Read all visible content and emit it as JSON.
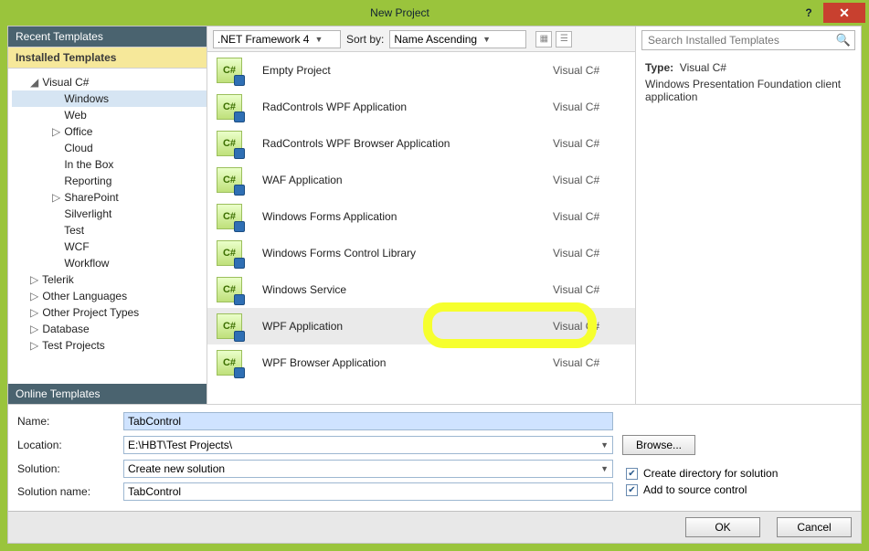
{
  "window": {
    "title": "New Project",
    "help": "?",
    "close": "✕"
  },
  "sidebar": {
    "headers": {
      "recent": "Recent Templates",
      "installed": "Installed Templates",
      "online": "Online Templates"
    },
    "tree": [
      {
        "label": "Visual C#",
        "depth": 1,
        "twisty": "◢",
        "exp": true
      },
      {
        "label": "Windows",
        "depth": 2,
        "twisty": "",
        "sel": true
      },
      {
        "label": "Web",
        "depth": 2,
        "twisty": ""
      },
      {
        "label": "Office",
        "depth": 2,
        "twisty": "▷"
      },
      {
        "label": "Cloud",
        "depth": 2,
        "twisty": ""
      },
      {
        "label": "In the Box",
        "depth": 2,
        "twisty": ""
      },
      {
        "label": "Reporting",
        "depth": 2,
        "twisty": ""
      },
      {
        "label": "SharePoint",
        "depth": 2,
        "twisty": "▷"
      },
      {
        "label": "Silverlight",
        "depth": 2,
        "twisty": ""
      },
      {
        "label": "Test",
        "depth": 2,
        "twisty": ""
      },
      {
        "label": "WCF",
        "depth": 2,
        "twisty": ""
      },
      {
        "label": "Workflow",
        "depth": 2,
        "twisty": ""
      },
      {
        "label": "Telerik",
        "depth": 1,
        "twisty": "▷"
      },
      {
        "label": "Other Languages",
        "depth": 1,
        "twisty": "▷"
      },
      {
        "label": "Other Project Types",
        "depth": 1,
        "twisty": "▷"
      },
      {
        "label": "Database",
        "depth": 1,
        "twisty": "▷"
      },
      {
        "label": "Test Projects",
        "depth": 1,
        "twisty": "▷"
      }
    ]
  },
  "toolbar": {
    "framework": ".NET Framework 4",
    "sortby_label": "Sort by:",
    "sortby_value": "Name Ascending"
  },
  "templates": [
    {
      "name": "Empty Project",
      "lang": "Visual C#"
    },
    {
      "name": "RadControls WPF Application",
      "lang": "Visual C#"
    },
    {
      "name": "RadControls WPF Browser Application",
      "lang": "Visual C#"
    },
    {
      "name": "WAF Application",
      "lang": "Visual C#"
    },
    {
      "name": "Windows Forms Application",
      "lang": "Visual C#"
    },
    {
      "name": "Windows Forms Control Library",
      "lang": "Visual C#"
    },
    {
      "name": "Windows Service",
      "lang": "Visual C#"
    },
    {
      "name": "WPF Application",
      "lang": "Visual C#",
      "sel": true,
      "highlight": true
    },
    {
      "name": "WPF Browser Application",
      "lang": "Visual C#"
    }
  ],
  "search": {
    "placeholder": "Search Installed Templates"
  },
  "info": {
    "type_label": "Type:",
    "type_value": "Visual C#",
    "desc": "Windows Presentation Foundation client application"
  },
  "form": {
    "name_label": "Name:",
    "name_value": "TabControl",
    "location_label": "Location:",
    "location_value": "E:\\HBT\\Test Projects\\",
    "browse": "Browse...",
    "solution_label": "Solution:",
    "solution_value": "Create new solution",
    "solname_label": "Solution name:",
    "solname_value": "TabControl",
    "chk1": "Create directory for solution",
    "chk2": "Add to source control"
  },
  "footer": {
    "ok": "OK",
    "cancel": "Cancel"
  }
}
